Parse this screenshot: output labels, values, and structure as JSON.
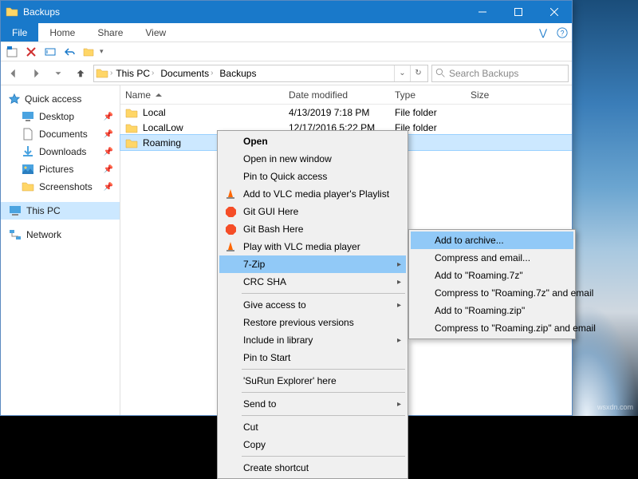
{
  "titlebar": {
    "title": "Backups"
  },
  "ribbon": {
    "file": "File",
    "tabs": [
      "Home",
      "Share",
      "View"
    ]
  },
  "breadcrumb": {
    "parts": [
      "This PC",
      "Documents",
      "Backups"
    ]
  },
  "search": {
    "placeholder": "Search Backups"
  },
  "navpane": {
    "quick_access": "Quick access",
    "items": [
      {
        "label": "Desktop"
      },
      {
        "label": "Documents"
      },
      {
        "label": "Downloads"
      },
      {
        "label": "Pictures"
      },
      {
        "label": "Screenshots"
      }
    ],
    "this_pc": "This PC",
    "network": "Network"
  },
  "columns": {
    "name": "Name",
    "date": "Date modified",
    "type": "Type",
    "size": "Size"
  },
  "rows": [
    {
      "name": "Local",
      "date": "4/13/2019 7:18 PM",
      "type": "File folder"
    },
    {
      "name": "LocalLow",
      "date": "12/17/2016 5:22 PM",
      "type": "File folder"
    },
    {
      "name": "Roaming",
      "date": "",
      "type": ""
    }
  ],
  "context_menu": {
    "open": "Open",
    "open_new": "Open in new window",
    "pin_qa": "Pin to Quick access",
    "vlc_playlist": "Add to VLC media player's Playlist",
    "git_gui": "Git GUI Here",
    "git_bash": "Git Bash Here",
    "vlc_play": "Play with VLC media player",
    "seven_zip": "7-Zip",
    "crc_sha": "CRC SHA",
    "give_access": "Give access to",
    "restore": "Restore previous versions",
    "include_lib": "Include in library",
    "pin_start": "Pin to Start",
    "surun": "'SuRun Explorer' here",
    "send_to": "Send to",
    "cut": "Cut",
    "copy": "Copy",
    "create_shortcut": "Create shortcut"
  },
  "submenu": {
    "add_archive": "Add to archive...",
    "compress_email": "Compress and email...",
    "add_7z": "Add to \"Roaming.7z\"",
    "compress_7z_email": "Compress to \"Roaming.7z\" and email",
    "add_zip": "Add to \"Roaming.zip\"",
    "compress_zip_email": "Compress to \"Roaming.zip\" and email"
  },
  "watermark": "wsxdn.com"
}
